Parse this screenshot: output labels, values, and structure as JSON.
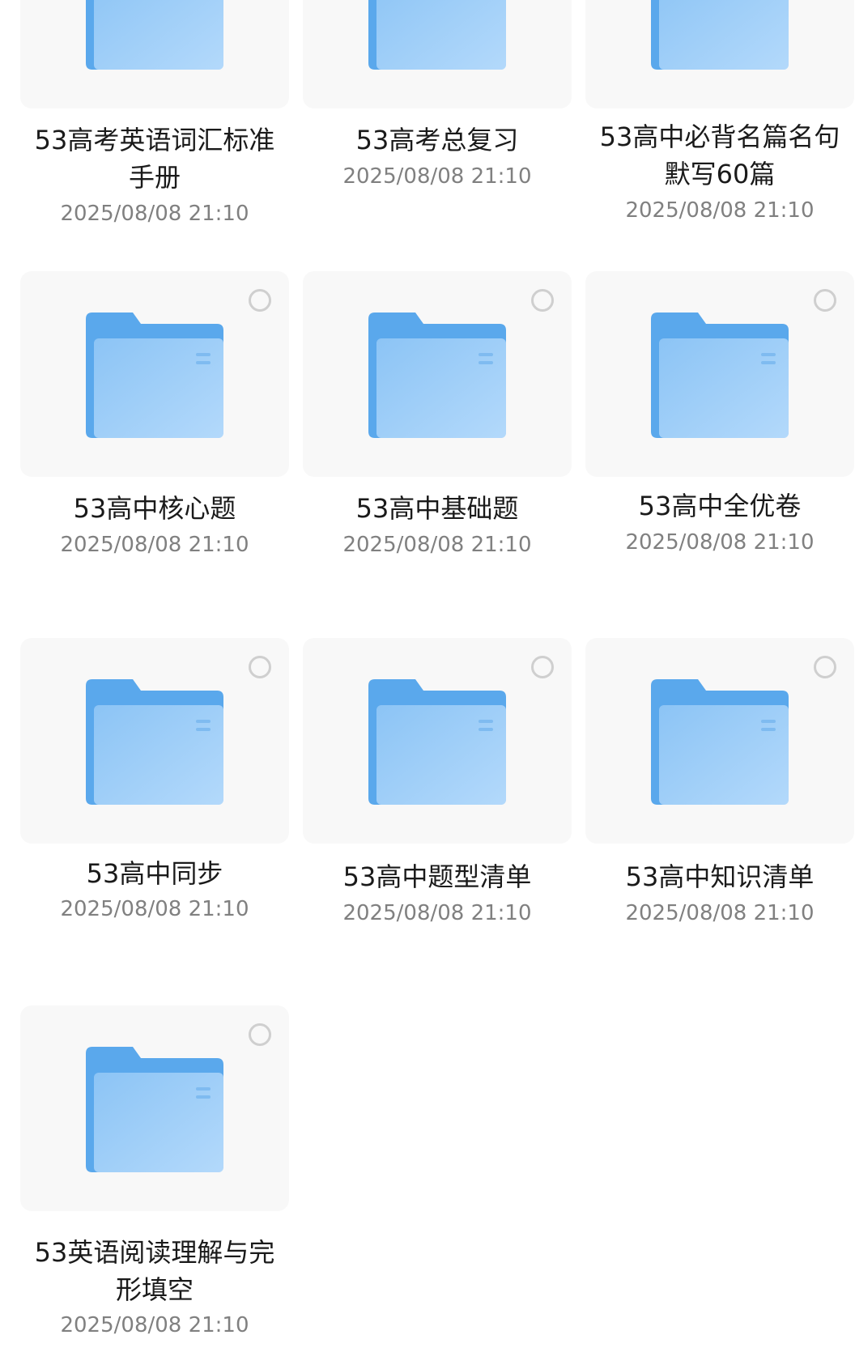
{
  "folders": [
    {
      "name": "53高考英语词汇标准手册",
      "date": "2025/08/08 21:10"
    },
    {
      "name": "53高考总复习",
      "date": "2025/08/08 21:10"
    },
    {
      "name": "53高中必背名篇名句默写60篇",
      "date": "2025/08/08 21:10"
    },
    {
      "name": "53高中核心题",
      "date": "2025/08/08 21:10"
    },
    {
      "name": "53高中基础题",
      "date": "2025/08/08 21:10"
    },
    {
      "name": "53高中全优卷",
      "date": "2025/08/08 21:10"
    },
    {
      "name": "53高中同步",
      "date": "2025/08/08 21:10"
    },
    {
      "name": "53高中题型清单",
      "date": "2025/08/08 21:10"
    },
    {
      "name": "53高中知识清单",
      "date": "2025/08/08 21:10"
    },
    {
      "name": "53英语阅读理解与完形填空",
      "date": "2025/08/08 21:10"
    }
  ],
  "colors": {
    "card_bg": "#f8f8f8",
    "folder_back": "#5aa8ec",
    "folder_front_start": "#8cc4f5",
    "folder_front_end": "#b3d9fb",
    "name_text": "#1a1a1a",
    "date_text": "#808080",
    "radio_border": "#cfcfcf"
  }
}
